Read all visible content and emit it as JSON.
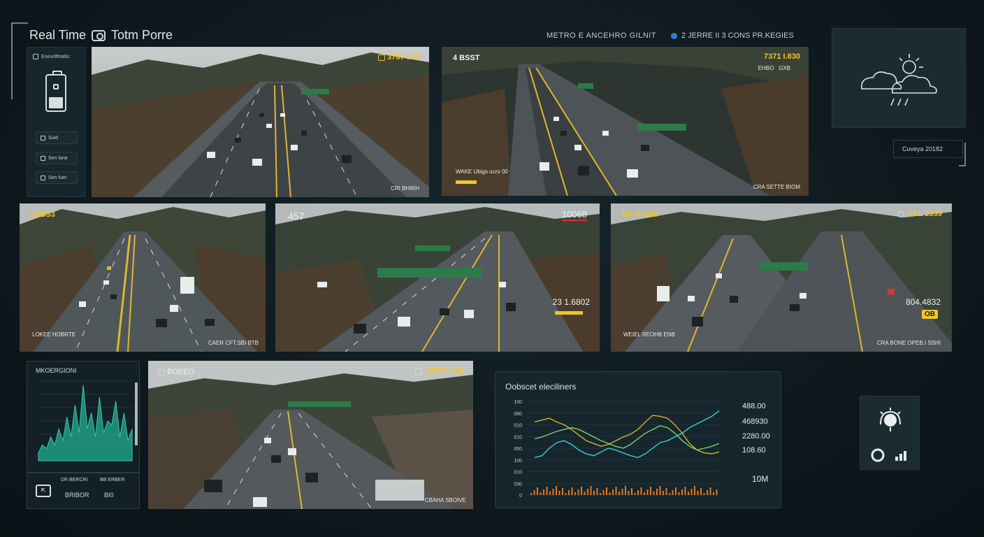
{
  "header": {
    "title_left": "Real Time",
    "title_right": "Totm Porre",
    "center_text": "METRO E ANCEHRO GILNIT",
    "status_text": "2 JERRE II 3 CONS PR.KEGIES"
  },
  "nav": {
    "top_label": "Eneurliftratlis",
    "buttons": [
      {
        "label": "Suid",
        "icon": "grid-icon"
      },
      {
        "label": "Sen lane",
        "icon": "camera-icon"
      },
      {
        "label": "Sen fuer",
        "icon": "list-icon"
      }
    ]
  },
  "cams": {
    "c1": {
      "top_right": "3767 930",
      "bottom_right": "CRI BHIRH"
    },
    "c2": {
      "top_left": "4 BSST",
      "top_right": "7371 I.830",
      "top_right_sub": "EHBO",
      "top_right_sub2": "GXB",
      "bottom_left": "WAKE Ubigs ucro 00",
      "bottom_right": "CRA SETTE BIOM"
    },
    "c3": {
      "top_left": "1.6BS3",
      "bottom_left": "LOKEE HOBRTE",
      "bottom_right": "CAER CFT.SBI BTB"
    },
    "c4": {
      "top_left": "457",
      "top_right": "10068",
      "mid_right": "23 1.6802"
    },
    "c5": {
      "top_left": "E8 75.E00",
      "top_right": "OBL 2939",
      "mid_right": "804.4832",
      "badge": "OB",
      "bottom_left": "WEIEL REOHB ENB",
      "bottom_right": "CRA BONE OPEB.I SSHI"
    },
    "c6": {
      "top_left": "BOEEO",
      "top_right": "4SETT 660",
      "bottom_right": "CBAHA SBOIVE"
    }
  },
  "weather": {
    "caption": "Cuveya 20182",
    "icon": "cloud-rain-sun-icon"
  },
  "mini_chart": {
    "title": "MKOERGIONI",
    "footer_a": "DR BERCRI",
    "footer_b": "BB ERBER",
    "footer_c": "BRIBOR",
    "footer_d": "BI0"
  },
  "chart": {
    "title": "Oobscet eleciliners",
    "y_ticks": [
      "100",
      "080",
      "010",
      "010",
      "000",
      "100",
      "010",
      "030",
      "0"
    ],
    "metrics": [
      "488.00",
      "468930",
      "2280.00",
      "108.60",
      "10M"
    ]
  },
  "chart_data": {
    "type": "line",
    "title": "Oobscet eleciliners",
    "x": [
      0,
      1,
      2,
      3,
      4,
      5,
      6,
      7,
      8,
      9,
      10,
      11,
      12,
      13,
      14,
      15,
      16,
      17,
      18,
      19,
      20,
      21,
      22,
      23,
      24,
      25
    ],
    "series": [
      {
        "name": "",
        "color": "#d4b52a",
        "values": [
          78,
          80,
          82,
          78,
          75,
          70,
          64,
          58,
          55,
          52,
          54,
          58,
          62,
          65,
          70,
          78,
          85,
          84,
          82,
          75,
          66,
          55,
          48,
          45,
          44,
          46
        ]
      },
      {
        "name": "",
        "color": "#3ccfd1",
        "values": [
          40,
          42,
          50,
          56,
          58,
          54,
          48,
          44,
          42,
          46,
          50,
          48,
          45,
          42,
          40,
          44,
          50,
          56,
          58,
          62,
          66,
          72,
          76,
          80,
          84,
          90
        ]
      },
      {
        "name": "",
        "color": "#7bd36a",
        "values": [
          60,
          62,
          65,
          68,
          70,
          72,
          70,
          66,
          62,
          58,
          55,
          52,
          50,
          54,
          60,
          66,
          70,
          74,
          72,
          66,
          58,
          52,
          48,
          50,
          52,
          55
        ]
      }
    ],
    "ylim": [
      0,
      100
    ]
  },
  "controls": {
    "settings_icon": "sun-settings-icon",
    "power_icon": "circle-icon",
    "signal_icon": "signal-bars-icon"
  }
}
